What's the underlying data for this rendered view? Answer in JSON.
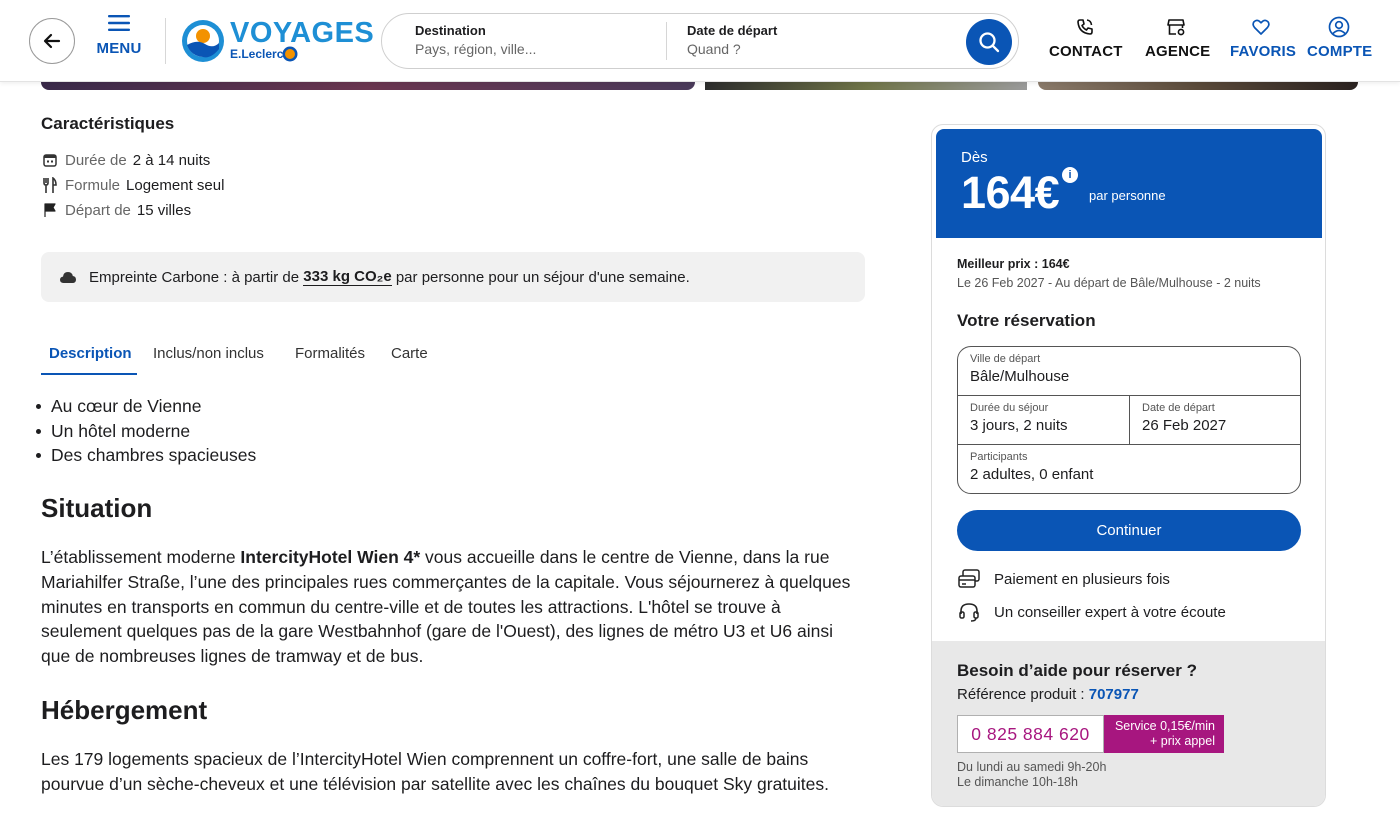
{
  "header": {
    "menu_label": "MENU",
    "logo_word": "VOYAGES",
    "logo_sub": "E.Leclerc",
    "search": {
      "destination_title": "Destination",
      "destination_placeholder": "Pays, région, ville...",
      "date_title": "Date de départ",
      "date_placeholder": "Quand ?"
    },
    "nav": {
      "contact": "CONTACT",
      "agence": "AGENCE",
      "favoris": "FAVORIS",
      "compte": "COMPTE"
    },
    "brand_color": "#0a55b5",
    "logo_color": "#1e8fd5"
  },
  "features": {
    "title": "Caractéristiques",
    "items": [
      {
        "icon": "calendar-icon",
        "key": "Durée de",
        "value": "2 à 14 nuits"
      },
      {
        "icon": "cutlery-icon",
        "key": "Formule",
        "value": "Logement seul"
      },
      {
        "icon": "flag-icon",
        "key": "Départ de",
        "value": "15 villes"
      }
    ]
  },
  "carbon": {
    "prefix": "Empreinte Carbone : à partir de",
    "value": "333 kg CO₂e",
    "suffix": "par personne pour un séjour d'une semaine."
  },
  "tabs": [
    "Description",
    "Inclus/non inclus",
    "Formalités",
    "Carte"
  ],
  "description": {
    "bullets": [
      "Au cœur de Vienne",
      "Un hôtel moderne",
      "Des chambres spacieuses"
    ],
    "situation_title": "Situation",
    "situation_pre": "L’établissement moderne ",
    "situation_hotel": "IntercityHotel Wien 4*",
    "situation_post": " vous accueille dans le centre de Vienne, dans la rue Mariahilfer Straße, l’une des principales rues commerçantes de la capitale. Vous séjournerez à quelques minutes en transports en commun du centre-ville et de toutes les attractions. L'hôtel se trouve à seulement quelques pas de la gare Westbahnhof (gare de l'Ouest), des lignes de métro U3 et U6 ainsi que de nombreuses lignes de tramway et de bus.",
    "hebergement_title": "Hébergement",
    "hebergement_text": "Les 179 logements spacieux de l’IntercityHotel Wien comprennent un coffre-fort, une salle de bains pourvue d’un sèche-cheveux et une télévision par satellite avec les chaînes du bouquet Sky gratuites."
  },
  "booking": {
    "price_prefix": "Dès",
    "price": "164€",
    "info_glyph": "i",
    "per_person": "par personne",
    "best_price": "Meilleur prix : 164€",
    "best_detail": "Le 26 Feb 2027 - Au départ de Bâle/Mulhouse - 2 nuits",
    "reservation_title": "Votre réservation",
    "fields": {
      "ville_label": "Ville de départ",
      "ville_value": "Bâle/Mulhouse",
      "duree_label": "Durée du séjour",
      "duree_value": "3 jours, 2 nuits",
      "date_label": "Date de départ",
      "date_value": "26 Feb 2027",
      "participants_label": "Participants",
      "participants_value": "2 adultes, 0 enfant"
    },
    "continue_label": "Continuer",
    "perks": [
      "Paiement en plusieurs fois",
      "Un conseiller expert à votre écoute"
    ],
    "help": {
      "title": "Besoin d’aide pour réserver ?",
      "ref_label": "Référence produit :",
      "ref_value": "707977",
      "phone": "0 825 884 620",
      "service_line1": "Service 0,15€/min",
      "service_line2": "+ prix appel",
      "hours_line1": "Du lundi au samedi 9h-20h",
      "hours_line2": "Le dimanche 10h-18h"
    },
    "accent_color": "#a7167f"
  }
}
